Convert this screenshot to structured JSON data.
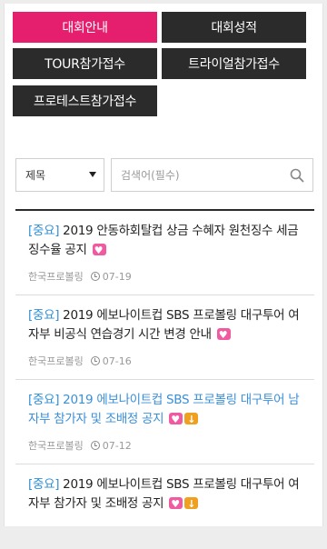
{
  "tabs": [
    {
      "label": "대회안내",
      "active": true
    },
    {
      "label": "대회성적",
      "active": false
    },
    {
      "label": "TOUR참가접수",
      "active": false
    },
    {
      "label": "트라이얼참가접수",
      "active": false
    },
    {
      "label": "프로테스트참가접수",
      "active": false
    }
  ],
  "search": {
    "field_selected": "제목",
    "placeholder": "검색어(필수)"
  },
  "posts": [
    {
      "tag": "[중요]",
      "title": " 2019 안동하회탈컵 상금 수혜자 원천징수 세금 징수율 공지",
      "author": "한국프로볼링",
      "date": "07-19"
    },
    {
      "tag": "[중요]",
      "title": " 2019 에보나이트컵 SBS 프로볼링 대구투어 여자부 비공식 연습경기 시간 변경 안내",
      "author": "한국프로볼링",
      "date": "07-16"
    },
    {
      "tag": "[중요]",
      "title": " 2019 에보나이트컵 SBS 프로볼링 대구투어 남자부 참가자 및 조배정 공지",
      "author": "한국프로볼링",
      "date": "07-12"
    },
    {
      "tag": "[중요]",
      "title": " 2019 에보나이트컵 SBS 프로볼링 대구투어 여자부 참가자 및 조배정 공지",
      "author": "",
      "date": ""
    }
  ],
  "colors": {
    "accent": "#e61e6e",
    "dark_tab": "#2b2b2b",
    "link_blue": "#3a8fd9"
  },
  "icons": {
    "search": "search-icon",
    "clock": "clock-icon",
    "new": "heart-badge-icon",
    "attachment": "download-badge-icon"
  }
}
